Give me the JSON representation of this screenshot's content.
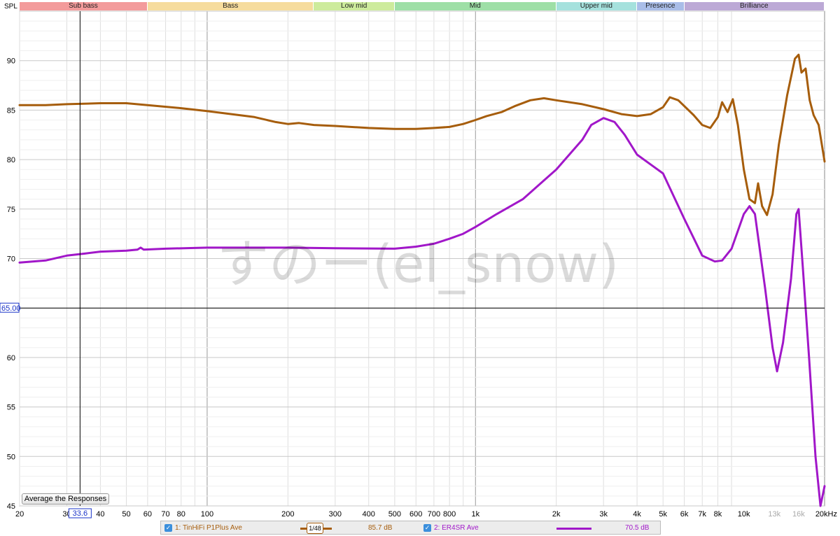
{
  "axis_label": "SPL",
  "bands": [
    {
      "label": "Sub bass",
      "color": "#f39b9b",
      "f0": 20,
      "f1": 60
    },
    {
      "label": "Bass",
      "color": "#f6dc9d",
      "f0": 60,
      "f1": 250
    },
    {
      "label": "Low mid",
      "color": "#cdeb9c",
      "f0": 250,
      "f1": 500
    },
    {
      "label": "Mid",
      "color": "#9edfa6",
      "f0": 500,
      "f1": 2000
    },
    {
      "label": "Upper mid",
      "color": "#a5e1dd",
      "f0": 2000,
      "f1": 4000
    },
    {
      "label": "Presence",
      "color": "#a9bde8",
      "f0": 4000,
      "f1": 6000
    },
    {
      "label": "Brilliance",
      "color": "#bca9d6",
      "f0": 6000,
      "f1": 20000
    }
  ],
  "cursor": {
    "x_label": "33.6",
    "y_label": "65.00",
    "x_value": 33.6,
    "y_value": 65.0
  },
  "watermark": "すのー(el_snow)",
  "average_button": "Average the Responses",
  "legend": {
    "item1": {
      "name": "1: TinHiFi P1Plus Ave",
      "value": "85.7 dB",
      "color": "#a65d0c",
      "check": "✓"
    },
    "smoothing": "1/48",
    "item2": {
      "name": "2: ER4SR Ave",
      "value": "70.5 dB",
      "color": "#a117c9",
      "check": "✓"
    }
  },
  "chart_data": {
    "type": "line",
    "xscale": "log",
    "xlim": [
      20,
      20000
    ],
    "ylim": [
      45,
      95
    ],
    "ylabel": "SPL",
    "grid": true,
    "y_ticks": [
      45,
      50,
      55,
      60,
      65,
      70,
      75,
      80,
      85,
      90
    ],
    "x_ticks": [
      {
        "v": 20,
        "t": "20"
      },
      {
        "v": 30,
        "t": "30"
      },
      {
        "v": 40,
        "t": "40"
      },
      {
        "v": 50,
        "t": "50"
      },
      {
        "v": 60,
        "t": "60"
      },
      {
        "v": 70,
        "t": "70"
      },
      {
        "v": 80,
        "t": "80"
      },
      {
        "v": 100,
        "t": "100"
      },
      {
        "v": 200,
        "t": "200"
      },
      {
        "v": 300,
        "t": "300"
      },
      {
        "v": 400,
        "t": "400"
      },
      {
        "v": 500,
        "t": "500"
      },
      {
        "v": 600,
        "t": "600"
      },
      {
        "v": 700,
        "t": "700"
      },
      {
        "v": 800,
        "t": "800"
      },
      {
        "v": 1000,
        "t": "1k"
      },
      {
        "v": 2000,
        "t": "2k"
      },
      {
        "v": 3000,
        "t": "3k"
      },
      {
        "v": 4000,
        "t": "4k"
      },
      {
        "v": 5000,
        "t": "5k"
      },
      {
        "v": 6000,
        "t": "6k"
      },
      {
        "v": 7000,
        "t": "7k"
      },
      {
        "v": 8000,
        "t": "8k"
      },
      {
        "v": 10000,
        "t": "10k"
      },
      {
        "v": 13000,
        "t": "13k",
        "muted": true
      },
      {
        "v": 16000,
        "t": "16k",
        "muted": true
      },
      {
        "v": 20000,
        "t": "20kHz"
      }
    ],
    "series": [
      {
        "name": "1: TinHiFi P1Plus Ave",
        "color": "#a65d0c",
        "points": [
          [
            20,
            85.5
          ],
          [
            25,
            85.5
          ],
          [
            30,
            85.6
          ],
          [
            40,
            85.7
          ],
          [
            50,
            85.7
          ],
          [
            60,
            85.5
          ],
          [
            80,
            85.2
          ],
          [
            100,
            84.9
          ],
          [
            150,
            84.3
          ],
          [
            180,
            83.8
          ],
          [
            200,
            83.6
          ],
          [
            220,
            83.7
          ],
          [
            250,
            83.5
          ],
          [
            300,
            83.4
          ],
          [
            400,
            83.2
          ],
          [
            500,
            83.1
          ],
          [
            600,
            83.1
          ],
          [
            700,
            83.2
          ],
          [
            800,
            83.3
          ],
          [
            900,
            83.6
          ],
          [
            1000,
            84.0
          ],
          [
            1100,
            84.4
          ],
          [
            1250,
            84.8
          ],
          [
            1400,
            85.4
          ],
          [
            1600,
            86.0
          ],
          [
            1800,
            86.2
          ],
          [
            2000,
            86.0
          ],
          [
            2500,
            85.6
          ],
          [
            3000,
            85.1
          ],
          [
            3500,
            84.6
          ],
          [
            4000,
            84.4
          ],
          [
            4500,
            84.6
          ],
          [
            5000,
            85.3
          ],
          [
            5300,
            86.3
          ],
          [
            5700,
            86.0
          ],
          [
            6500,
            84.5
          ],
          [
            7000,
            83.5
          ],
          [
            7500,
            83.2
          ],
          [
            8000,
            84.3
          ],
          [
            8300,
            85.8
          ],
          [
            8700,
            84.8
          ],
          [
            9100,
            86.1
          ],
          [
            9500,
            83.5
          ],
          [
            10000,
            79.0
          ],
          [
            10500,
            76.0
          ],
          [
            11000,
            75.6
          ],
          [
            11300,
            77.6
          ],
          [
            11700,
            75.3
          ],
          [
            12200,
            74.4
          ],
          [
            12800,
            76.5
          ],
          [
            13500,
            81.5
          ],
          [
            14500,
            86.5
          ],
          [
            15500,
            90.2
          ],
          [
            16000,
            90.6
          ],
          [
            16400,
            88.8
          ],
          [
            17000,
            89.2
          ],
          [
            17600,
            86.0
          ],
          [
            18200,
            84.5
          ],
          [
            19000,
            83.5
          ],
          [
            20000,
            79.8
          ]
        ]
      },
      {
        "name": "2: ER4SR Ave",
        "color": "#a117c9",
        "points": [
          [
            20,
            69.6
          ],
          [
            25,
            69.8
          ],
          [
            30,
            70.3
          ],
          [
            35,
            70.5
          ],
          [
            40,
            70.7
          ],
          [
            50,
            70.8
          ],
          [
            55,
            70.9
          ],
          [
            56.5,
            71.1
          ],
          [
            58,
            70.9
          ],
          [
            70,
            71.0
          ],
          [
            100,
            71.1
          ],
          [
            200,
            71.1
          ],
          [
            300,
            71.05
          ],
          [
            500,
            71.0
          ],
          [
            600,
            71.2
          ],
          [
            700,
            71.5
          ],
          [
            800,
            72.0
          ],
          [
            900,
            72.5
          ],
          [
            1000,
            73.2
          ],
          [
            1200,
            74.5
          ],
          [
            1500,
            76.0
          ],
          [
            2000,
            79.0
          ],
          [
            2500,
            82.0
          ],
          [
            2700,
            83.5
          ],
          [
            3000,
            84.2
          ],
          [
            3300,
            83.8
          ],
          [
            3600,
            82.5
          ],
          [
            4000,
            80.5
          ],
          [
            4500,
            79.5
          ],
          [
            5000,
            78.6
          ],
          [
            6000,
            74.0
          ],
          [
            7000,
            70.3
          ],
          [
            7800,
            69.7
          ],
          [
            8300,
            69.8
          ],
          [
            9000,
            71.0
          ],
          [
            10000,
            74.5
          ],
          [
            10500,
            75.3
          ],
          [
            11000,
            74.5
          ],
          [
            12000,
            67.0
          ],
          [
            12800,
            61.0
          ],
          [
            13300,
            58.6
          ],
          [
            14000,
            61.5
          ],
          [
            15000,
            68.0
          ],
          [
            15700,
            74.5
          ],
          [
            16000,
            75.0
          ],
          [
            16600,
            69.0
          ],
          [
            17500,
            60.0
          ],
          [
            18500,
            50.0
          ],
          [
            19300,
            44.5
          ],
          [
            20000,
            47.0
          ]
        ]
      }
    ]
  }
}
